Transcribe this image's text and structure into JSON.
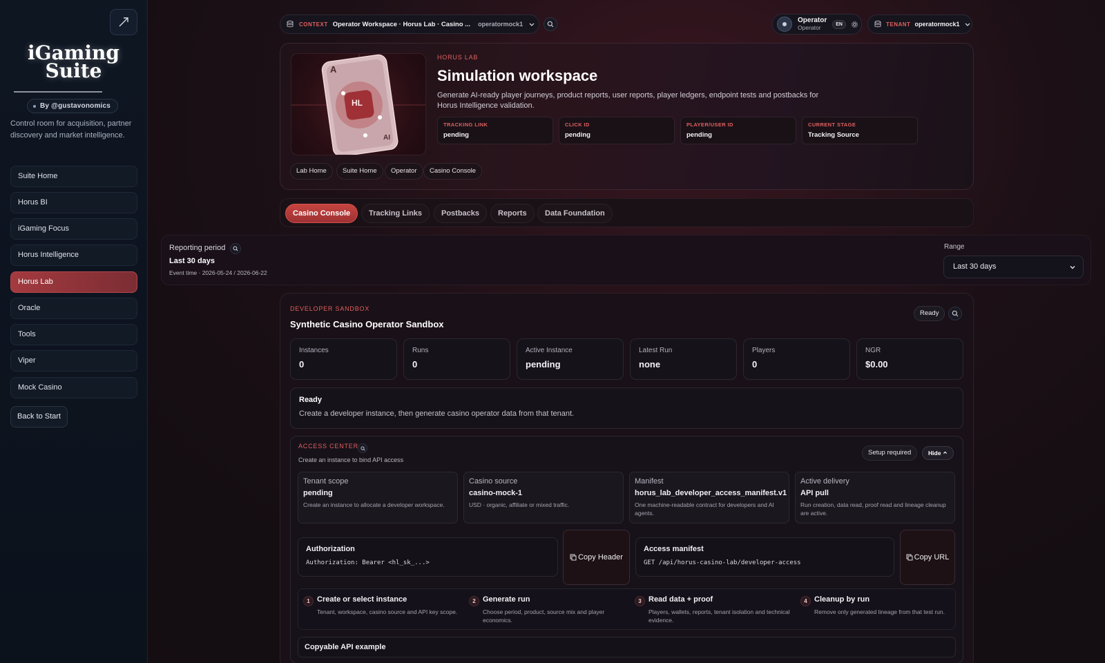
{
  "sidebar": {
    "logo_line1": "iGaming",
    "logo_line2": "Suite",
    "byline": "By @gustavonomics",
    "tagline": "Control room for acquisition, partner discovery and market intelligence.",
    "items": [
      {
        "label": "Suite Home"
      },
      {
        "label": "Horus BI"
      },
      {
        "label": "iGaming Focus"
      },
      {
        "label": "Horus Intelligence"
      },
      {
        "label": "Horus Lab"
      },
      {
        "label": "Oracle"
      },
      {
        "label": "Tools"
      },
      {
        "label": "Viper"
      },
      {
        "label": "Mock Casino"
      }
    ],
    "active_item": "Horus Lab",
    "back_label": "Back to Start"
  },
  "topbar": {
    "context_label": "CONTEXT",
    "context_value": "Operator Workspace · Horus Lab · Casino ...",
    "context_user": "operatormock1",
    "user_name": "Operator",
    "user_role": "Operator",
    "lang": "EN",
    "tenant_label": "TENANT",
    "tenant_value": "operatormock1"
  },
  "hero": {
    "eyebrow": "HORUS LAB",
    "title": "Simulation workspace",
    "description": "Generate AI-ready player journeys, product reports, user reports, player ledgers, endpoint tests and postbacks for Horus Intelligence validation.",
    "card_letter_top": "A",
    "card_badge": "HL",
    "card_letter_bottom": "AI",
    "stats": [
      {
        "label": "TRACKING LINK",
        "value": "pending"
      },
      {
        "label": "CLICK ID",
        "value": "pending"
      },
      {
        "label": "PLAYER/USER ID",
        "value": "pending"
      },
      {
        "label": "CURRENT STAGE",
        "value": "Tracking Source"
      }
    ],
    "chips": [
      "Lab Home",
      "Suite Home",
      "Operator",
      "Casino Console"
    ]
  },
  "tabs": [
    "Casino Console",
    "Tracking Links",
    "Postbacks",
    "Reports",
    "Data Foundation"
  ],
  "active_tab": "Casino Console",
  "period": {
    "label": "Reporting period",
    "value": "Last 30 days",
    "event_time": "Event time · 2026-05-24 / 2026-06-22",
    "range_label": "Range",
    "range_value": "Last 30 days"
  },
  "sandbox": {
    "eyebrow": "DEVELOPER SANDBOX",
    "title": "Synthetic Casino Operator Sandbox",
    "status": "Ready",
    "metrics": [
      {
        "label": "Instances",
        "value": "0"
      },
      {
        "label": "Runs",
        "value": "0"
      },
      {
        "label": "Active Instance",
        "value": "pending"
      },
      {
        "label": "Latest Run",
        "value": "none"
      },
      {
        "label": "Players",
        "value": "0"
      },
      {
        "label": "NGR",
        "value": "$0.00"
      }
    ],
    "ready_title": "Ready",
    "ready_text": "Create a developer instance, then generate casino operator data from that tenant."
  },
  "access": {
    "eyebrow": "ACCESS CENTER",
    "subtitle": "Create an instance to bind API access",
    "setup_status": "Setup required",
    "hide_label": "Hide",
    "cards": [
      {
        "label": "Tenant scope",
        "value": "pending",
        "desc": "Create an instance to allocate a developer workspace."
      },
      {
        "label": "Casino source",
        "value": "casino-mock-1",
        "desc": "USD · organic, affiliate or mixed traffic."
      },
      {
        "label": "Manifest",
        "value": "horus_lab_developer_access_manifest.v1",
        "desc": "One machine-readable contract for developers and AI agents."
      },
      {
        "label": "Active delivery",
        "value": "API pull",
        "desc": "Run creation, data read, proof read and lineage cleanup are active."
      }
    ],
    "auth_title": "Authorization",
    "auth_code": "Authorization: Bearer <hl_sk_...>",
    "copy_header": "Copy Header",
    "manifest_title": "Access manifest",
    "manifest_code": "GET /api/horus-casino-lab/developer-access",
    "copy_url": "Copy URL",
    "steps": [
      {
        "num": "1",
        "title": "Create or select instance",
        "desc": "Tenant, workspace, casino source and API key scope."
      },
      {
        "num": "2",
        "title": "Generate run",
        "desc": "Choose period, product, source mix and player economics."
      },
      {
        "num": "3",
        "title": "Read data + proof",
        "desc": "Players, wallets, reports, tenant isolation and technical evidence."
      },
      {
        "num": "4",
        "title": "Cleanup by run",
        "desc": "Remove only generated lineage from that test run."
      }
    ],
    "api_example": "Copyable API example"
  },
  "colors": {
    "accent": "#c5443f",
    "label_red": "#e0605e"
  }
}
